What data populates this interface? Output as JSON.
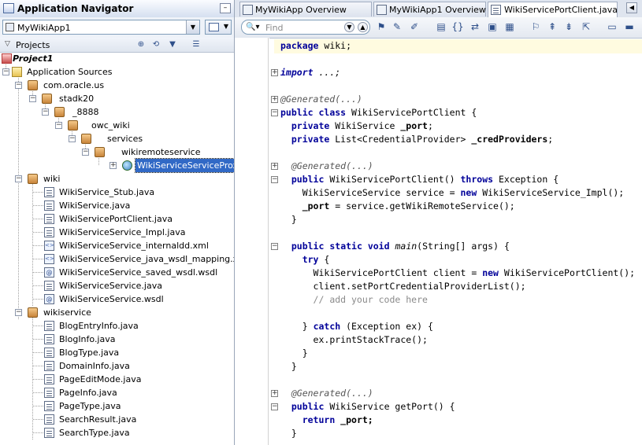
{
  "navigator": {
    "title": "Application Navigator",
    "minimize_label": "–",
    "app_selector_value": "MyWikiApp1",
    "projects_label": "Projects"
  },
  "tree": {
    "project": "Project1",
    "app_sources": "Application Sources",
    "com_oracle_us": "com.oracle.us",
    "stadk20": "stadk20",
    "p8888": "_8888",
    "owc_wiki": "owc_wiki",
    "services": "services",
    "wikiremoteservice": "wikiremoteservice",
    "proxy": "WikiServiceServiceProxy",
    "wiki": "wiki",
    "wiki_files": [
      "WikiService_Stub.java",
      "WikiService.java",
      "WikiServicePortClient.java",
      "WikiServiceService_Impl.java",
      "WikiServiceService_internaldd.xml",
      "WikiServiceService_java_wsdl_mapping.xml",
      "WikiServiceService_saved_wsdl.wsdl",
      "WikiServiceService.java",
      "WikiServiceService.wsdl"
    ],
    "wikiservice": "wikiservice",
    "wikiservice_files": [
      "BlogEntryInfo.java",
      "BlogInfo.java",
      "BlogType.java",
      "DomainInfo.java",
      "PageEditMode.java",
      "PageInfo.java",
      "PageType.java",
      "SearchResult.java",
      "SearchType.java"
    ]
  },
  "tabs": [
    {
      "label": "MyWikiApp Overview"
    },
    {
      "label": "MyWikiApp1 Overview"
    },
    {
      "label": "WikiServicePortClient.java"
    }
  ],
  "toolbar": {
    "find_placeholder": "Find"
  },
  "code": {
    "package_kw": "package",
    "package_name": " wiki;",
    "import_kw": "import",
    "import_rest": " ...;",
    "generated": "@Generated(...)",
    "public": "public",
    "class": "class",
    "class_name": " WikiServicePortClient {",
    "private": "private",
    "field1_type": " WikiService ",
    "field1_name": "_port",
    "field2_type": " List<CredentialProvider> ",
    "field2_name": "_credProviders",
    "ctor_name": " WikiServicePortClient() ",
    "throws": "throws",
    "exception": " Exception {",
    "ctor_body1a": "WikiServiceService service = ",
    "new": "new",
    "ctor_body1b": " WikiServiceService_Impl();",
    "ctor_body2a": "_port",
    "ctor_body2b": " = service.getWikiRemoteService();",
    "close": "}",
    "static": "static",
    "void": "void",
    "main": "main",
    "main_args": "(String[] args) {",
    "try": "try",
    "try_open": " {",
    "client_a": "WikiServicePortClient client = ",
    "client_b": " WikiServicePortClient();",
    "setport": "client.setPortCredentialProviderList();",
    "comment": "// add your code here",
    "catch_close": "} ",
    "catch": "catch",
    "catch_rest": " (Exception ex) {",
    "stack": "ex.printStackTrace();",
    "getport_a": " WikiService getPort() {",
    "return": "return",
    "return_b": " _port;"
  }
}
